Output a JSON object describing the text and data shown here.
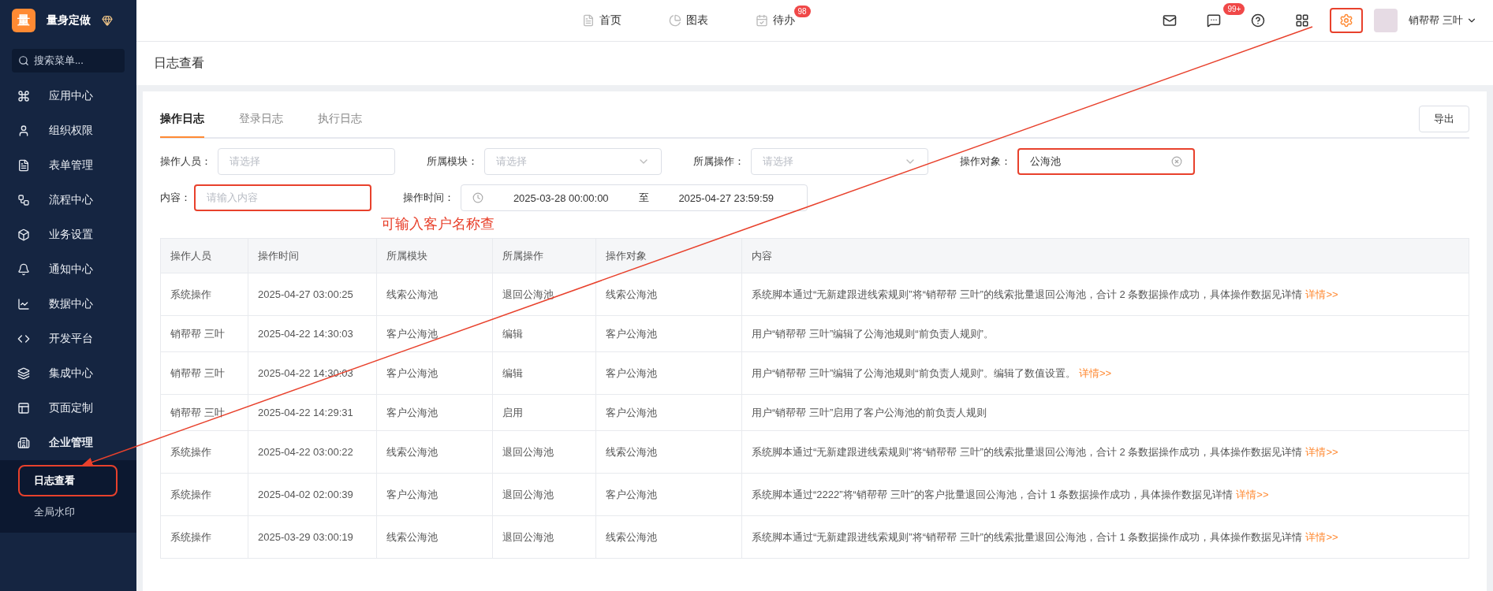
{
  "brand": {
    "logo": "量",
    "name": "量身定做"
  },
  "sidebar": {
    "search_placeholder": "搜索菜单...",
    "items": [
      {
        "kind": "apps",
        "label": "应用中心",
        "expanded": false
      },
      {
        "kind": "user",
        "label": "组织权限",
        "expanded": false
      },
      {
        "kind": "form",
        "label": "表单管理",
        "expanded": false
      },
      {
        "kind": "flow",
        "label": "流程中心",
        "expanded": false
      },
      {
        "kind": "box",
        "label": "业务设置",
        "expanded": false
      },
      {
        "kind": "bell",
        "label": "通知中心",
        "expanded": false
      },
      {
        "kind": "chart",
        "label": "数据中心",
        "expanded": false
      },
      {
        "kind": "code",
        "label": "开发平台",
        "expanded": false
      },
      {
        "kind": "layers",
        "label": "集成中心",
        "expanded": false
      },
      {
        "kind": "layout",
        "label": "页面定制",
        "expanded": false
      },
      {
        "kind": "building",
        "label": "企业管理",
        "expanded": true,
        "children": [
          {
            "label": "日志查看",
            "selected": true,
            "highlighted": true
          },
          {
            "label": "全局水印",
            "selected": false,
            "highlighted": false
          }
        ]
      }
    ]
  },
  "topnav": [
    {
      "kind": "home",
      "label": "首页"
    },
    {
      "kind": "chart",
      "label": "图表"
    },
    {
      "kind": "todo",
      "label": "待办",
      "badge": "98"
    }
  ],
  "toolbar": [
    {
      "kind": "mail",
      "highlighted": false
    },
    {
      "kind": "message",
      "badge": "99+",
      "highlighted": false
    },
    {
      "kind": "help",
      "highlighted": false
    },
    {
      "kind": "grid",
      "highlighted": false
    },
    {
      "kind": "settings",
      "highlighted": true
    }
  ],
  "user": {
    "name": "销帮帮 三叶"
  },
  "page_title": "日志查看",
  "tabs": [
    {
      "label": "操作日志",
      "selected": true
    },
    {
      "label": "登录日志",
      "selected": false
    },
    {
      "label": "执行日志",
      "selected": false
    }
  ],
  "export_button": "导出",
  "filters": [
    [
      {
        "kind": "input",
        "label": "操作人员：",
        "placeholder": "请选择",
        "highlighted": false
      },
      {
        "kind": "select",
        "label": "所属模块：",
        "placeholder": "请选择",
        "highlighted": false
      },
      {
        "kind": "select",
        "label": "所属操作：",
        "placeholder": "请选择",
        "highlighted": false
      },
      {
        "kind": "input",
        "label": "操作对象：",
        "value": "公海池",
        "highlighted": true
      }
    ],
    [
      {
        "kind": "input",
        "label": "内容：",
        "placeholder": "请输入内容",
        "highlighted": true
      },
      {
        "kind": "daterange",
        "label": "操作时间：",
        "start": "2025-03-28 00:00:00",
        "separator": "至",
        "end": "2025-04-27 23:59:59",
        "highlighted": false
      }
    ]
  ],
  "annotation": "可输入客户名称查",
  "table": {
    "columns": [
      "操作人员",
      "操作时间",
      "所属模块",
      "所属操作",
      "操作对象",
      "内容"
    ],
    "rows": [
      {
        "cells": [
          "系统操作",
          "2025-04-27 03:00:25",
          "线索公海池",
          "退回公海池",
          "线索公海池"
        ],
        "content": "系统脚本通过“无新建跟进线索规则”将“销帮帮 三叶”的线索批量退回公海池，合计 2 条数据操作成功，具体操作数据见详情",
        "link": "详情>>"
      },
      {
        "cells": [
          "销帮帮 三叶",
          "2025-04-22 14:30:03",
          "客户公海池",
          "编辑",
          "客户公海池"
        ],
        "content": "用户“销帮帮 三叶”编辑了公海池规则“前负责人规则”。"
      },
      {
        "cells": [
          "销帮帮 三叶",
          "2025-04-22 14:30:03",
          "客户公海池",
          "编辑",
          "客户公海池"
        ],
        "content": "用户“销帮帮 三叶”编辑了公海池规则“前负责人规则”。编辑了数值设置。",
        "link": "详情>>"
      },
      {
        "cells": [
          "销帮帮 三叶",
          "2025-04-22 14:29:31",
          "客户公海池",
          "启用",
          "客户公海池"
        ],
        "content": "用户“销帮帮 三叶”启用了客户公海池的前负责人规则"
      },
      {
        "cells": [
          "系统操作",
          "2025-04-22 03:00:22",
          "线索公海池",
          "退回公海池",
          "线索公海池"
        ],
        "content": "系统脚本通过“无新建跟进线索规则”将“销帮帮 三叶”的线索批量退回公海池，合计 2 条数据操作成功，具体操作数据见详情",
        "link": "详情>>"
      },
      {
        "cells": [
          "系统操作",
          "2025-04-02 02:00:39",
          "客户公海池",
          "退回公海池",
          "客户公海池"
        ],
        "content": "系统脚本通过“2222”将“销帮帮 三叶”的客户批量退回公海池，合计 1 条数据操作成功，具体操作数据见详情",
        "link": "详情>>"
      },
      {
        "cells": [
          "系统操作",
          "2025-03-29 03:00:19",
          "线索公海池",
          "退回公海池",
          "线索公海池"
        ],
        "content": "系统脚本通过“无新建跟进线索规则”将“销帮帮 三叶”的线索批量退回公海池，合计 1 条数据操作成功，具体操作数据见详情",
        "link": "详情>>"
      }
    ]
  }
}
